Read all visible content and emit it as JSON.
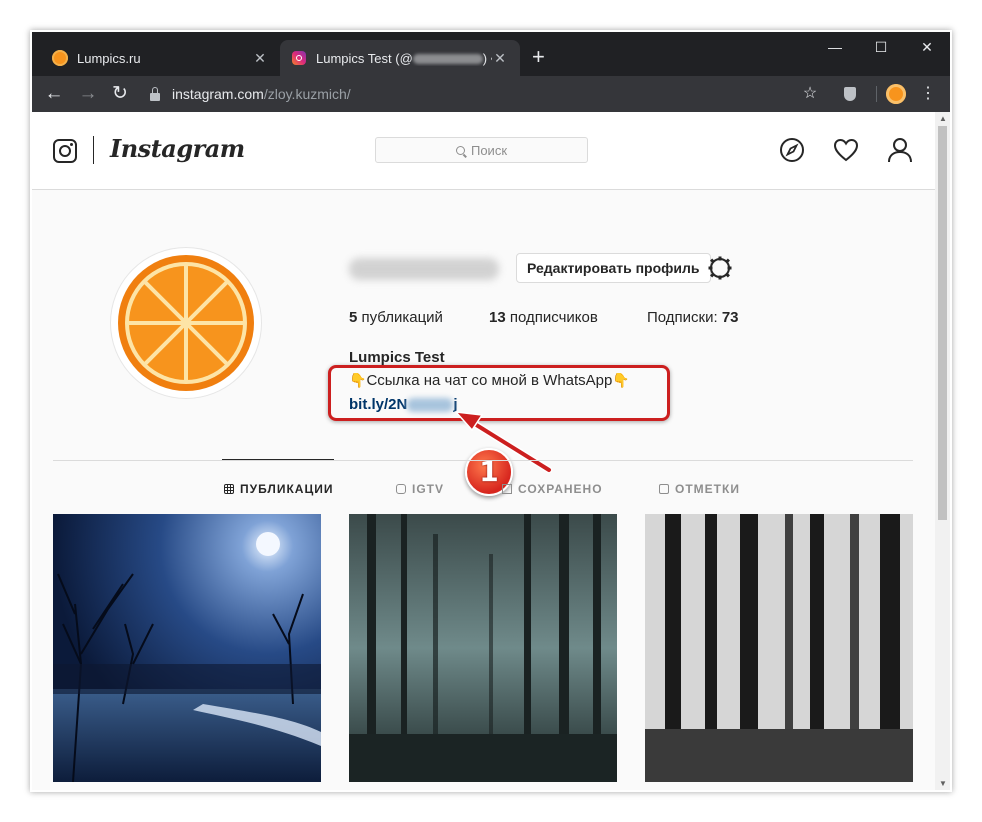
{
  "browser": {
    "tabs": [
      {
        "title": "Lumpics.ru",
        "active": false
      },
      {
        "title_prefix": "Lumpics Test (@",
        "title_suffix": ") • ",
        "active": true
      }
    ],
    "new_tab_label": "+",
    "window_controls": {
      "minimize": "—",
      "maximize": "☐",
      "close": "✕"
    },
    "url_host": "instagram.com",
    "url_path": "/zloy.kuzmich/"
  },
  "instagram": {
    "logo_text": "Instagram",
    "search_placeholder": "Поиск",
    "nav_icons": [
      "explore-icon",
      "heart-icon",
      "profile-icon"
    ],
    "edit_profile_label": "Редактировать профиль",
    "stats": {
      "posts_count": "5",
      "posts_label": " публикаций",
      "followers_count": "13",
      "followers_label": " подписчиков",
      "following_label": "Подписки: ",
      "following_count": "73"
    },
    "full_name": "Lumpics Test",
    "bio_text": "Ссылка на чат со мной в WhatsApp",
    "bio_emoji": "👇",
    "bio_link_prefix": "bit.ly/2N",
    "bio_link_suffix": "j",
    "tabs": [
      {
        "label": "ПУБЛИКАЦИИ",
        "active": true
      },
      {
        "label": "IGTV",
        "active": false
      },
      {
        "label": "СОХРАНЕНО",
        "active": false
      },
      {
        "label": "ОТМЕТКИ",
        "active": false
      }
    ]
  },
  "annotation": {
    "step_number": "1"
  },
  "colors": {
    "accent_orange": "#f7941d",
    "highlight_red": "#cc1f1f",
    "link_blue": "#003569"
  }
}
